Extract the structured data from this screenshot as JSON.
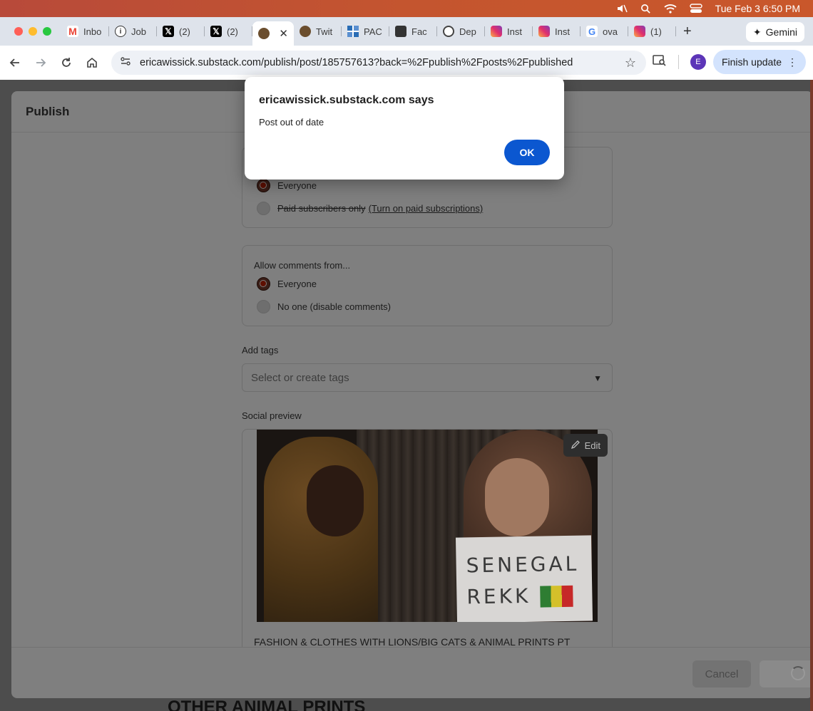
{
  "menubar": {
    "datetime": "Tue Feb 3  6:50 PM"
  },
  "tabs": [
    {
      "label": "Inbo",
      "icon": "gmail-icon"
    },
    {
      "label": "Job",
      "icon": "info-icon"
    },
    {
      "label": "(2)",
      "icon": "x-icon"
    },
    {
      "label": "(2)",
      "icon": "x-icon"
    },
    {
      "label": "",
      "icon": "cat-icon",
      "active": true
    },
    {
      "label": "Twit",
      "icon": "cat-icon"
    },
    {
      "label": "PAC",
      "icon": "grid-icon"
    },
    {
      "label": "Fac",
      "icon": "calendar-icon"
    },
    {
      "label": "Dep",
      "icon": "dep-icon"
    },
    {
      "label": "Inst",
      "icon": "instagram-icon"
    },
    {
      "label": "Inst",
      "icon": "instagram-icon"
    },
    {
      "label": "ova",
      "icon": "google-icon"
    },
    {
      "label": "(1)",
      "icon": "instagram-icon"
    }
  ],
  "browser": {
    "gemini_label": "Gemini",
    "url": "ericawissick.substack.com/publish/post/185757613?back=%2Fpublish%2Fposts%2Fpublished",
    "avatar_letter": "E",
    "finish_update_label": "Finish update"
  },
  "panel": {
    "title": "Publish",
    "audience": {
      "option_everyone": "Everyone",
      "option_paid": "Paid subscribers only",
      "paid_link": "(Turn on paid subscriptions)"
    },
    "comments": {
      "title": "Allow comments from...",
      "option_everyone": "Everyone",
      "option_none": "No one (disable comments)"
    },
    "tags": {
      "label": "Add tags",
      "placeholder": "Select or create tags"
    },
    "social_preview": {
      "label": "Social preview",
      "edit_label": "Edit",
      "sign_line1": "SENEGAL",
      "sign_line2": "REKK",
      "post_title": "FASHION & CLOTHES WITH LIONS/BIG CATS & ANIMAL PRINTS PT"
    },
    "footer": {
      "cancel_label": "Cancel"
    },
    "below_text": "OTHER ANIMAL PRINTS"
  },
  "alert": {
    "title": "ericawissick.substack.com says",
    "message": "Post out of date",
    "ok_label": "OK"
  }
}
